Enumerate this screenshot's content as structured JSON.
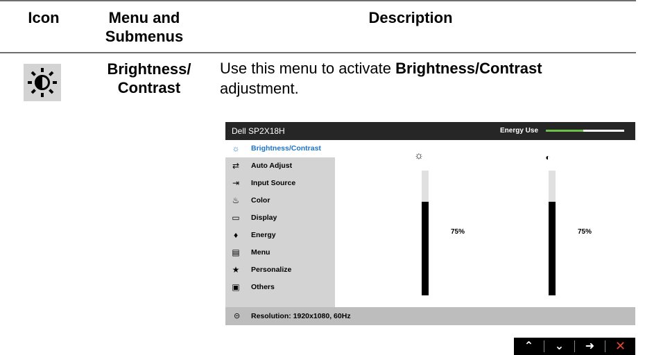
{
  "table": {
    "headers": {
      "icon": "Icon",
      "menu": "Menu and Submenus",
      "description": "Description"
    },
    "row": {
      "icon": "brightness-sun-icon",
      "menu": "Brightness/ Contrast",
      "desc_prefix": "Use this menu to activate ",
      "desc_bold": "Brightness/Contrast",
      "desc_suffix": " adjustment."
    }
  },
  "osd": {
    "model": "Dell SP2X18H",
    "energy_label": "Energy Use",
    "energy_level": 0.48,
    "menu_items": [
      {
        "label": "Brightness/Contrast",
        "icon": "brightness-icon",
        "selected": true
      },
      {
        "label": "Auto Adjust",
        "icon": "auto-adjust-icon",
        "selected": false
      },
      {
        "label": "Input Source",
        "icon": "input-source-icon",
        "selected": false
      },
      {
        "label": "Color",
        "icon": "color-icon",
        "selected": false
      },
      {
        "label": "Display",
        "icon": "display-icon",
        "selected": false
      },
      {
        "label": "Energy",
        "icon": "energy-icon",
        "selected": false
      },
      {
        "label": "Menu",
        "icon": "menu-icon",
        "selected": false
      },
      {
        "label": "Personalize",
        "icon": "star-icon",
        "selected": false
      },
      {
        "label": "Others",
        "icon": "others-icon",
        "selected": false
      }
    ],
    "brightness": {
      "value": 75,
      "label": "75%",
      "icon": "sun-icon"
    },
    "contrast": {
      "value": 75,
      "label": "75%",
      "icon": "contrast-icon"
    },
    "status": {
      "icon": "resolution-icon",
      "text": "Resolution: 1920x1080, 60Hz"
    },
    "selected_color": "#1a73c8",
    "energy_color": "#6cc04a"
  },
  "nav_buttons": [
    {
      "name": "up",
      "icon": "chevron-up-icon"
    },
    {
      "name": "down",
      "icon": "chevron-down-icon"
    },
    {
      "name": "enter",
      "icon": "arrow-right-icon"
    },
    {
      "name": "exit",
      "icon": "close-icon",
      "color": "#e8442e"
    }
  ]
}
